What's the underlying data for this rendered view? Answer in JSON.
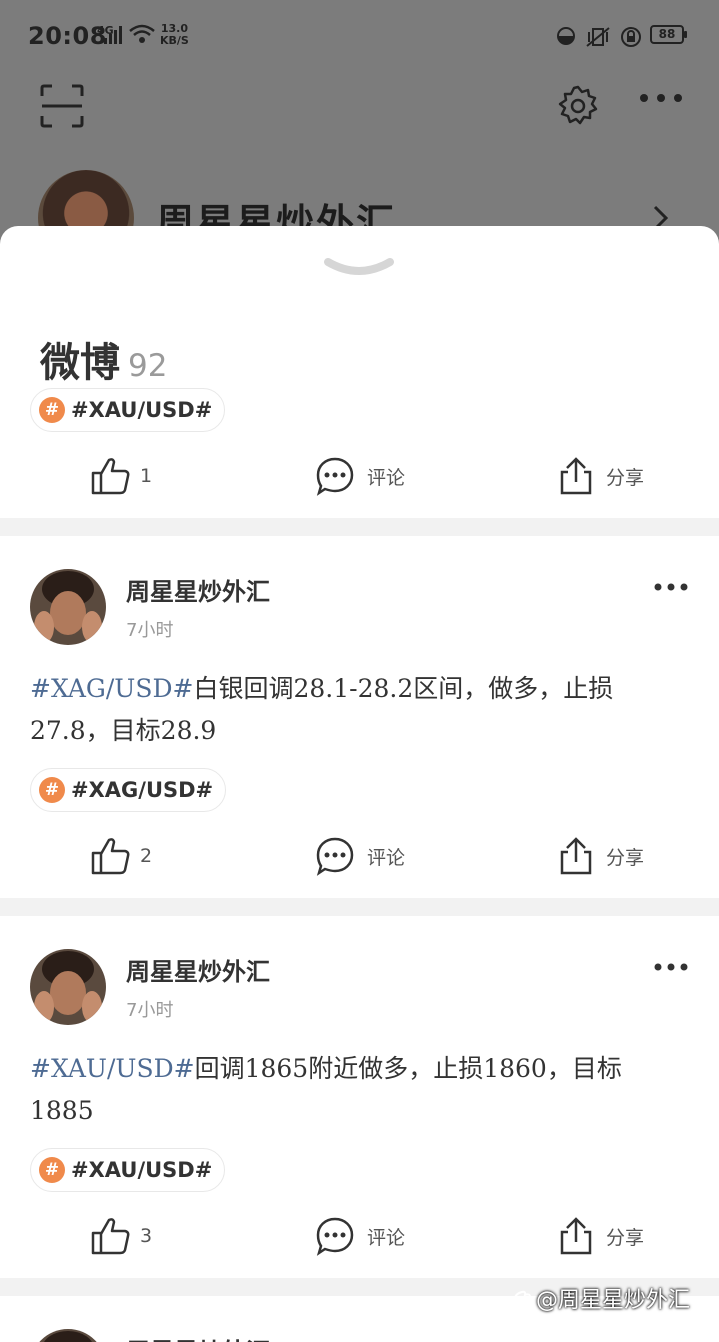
{
  "status": {
    "time": "20:08",
    "network": "4G",
    "speed_value": "13.0",
    "speed_unit": "KB/S",
    "battery": "88"
  },
  "profile": {
    "name": "周星星炒外汇"
  },
  "sheet": {
    "title": "微博",
    "count": "92",
    "summary_topic": "#XAU/USD#",
    "summary_actions": {
      "like_count": "1",
      "comment_label": "评论",
      "share_label": "分享"
    }
  },
  "posts": [
    {
      "author": "周星星炒外汇",
      "time": "7小时",
      "tag": "#XAG/USD#",
      "text": "白银回调28.1-28.2区间，做多，止损27.8，目标28.9",
      "topic": "#XAG/USD#",
      "like_count": "2",
      "comment_label": "评论",
      "share_label": "分享"
    },
    {
      "author": "周星星炒外汇",
      "time": "7小时",
      "tag": "#XAU/USD#",
      "text": "回调1865附近做多，止损1860，目标1885",
      "topic": "#XAU/USD#",
      "like_count": "3",
      "comment_label": "评论",
      "share_label": "分享"
    },
    {
      "author": "周星星炒外汇"
    }
  ],
  "watermark": "@周星星炒外汇",
  "icons": [
    "scan-icon",
    "gear-icon",
    "more-icon",
    "chevron-right-icon",
    "chevron-down-icon",
    "hash-icon",
    "thumb-up-icon",
    "comment-icon",
    "share-icon"
  ],
  "colors": {
    "accent_orange": "#f08a4b",
    "tag_blue": "#4e6b93",
    "overlay_gray": "#7b7b7b"
  }
}
